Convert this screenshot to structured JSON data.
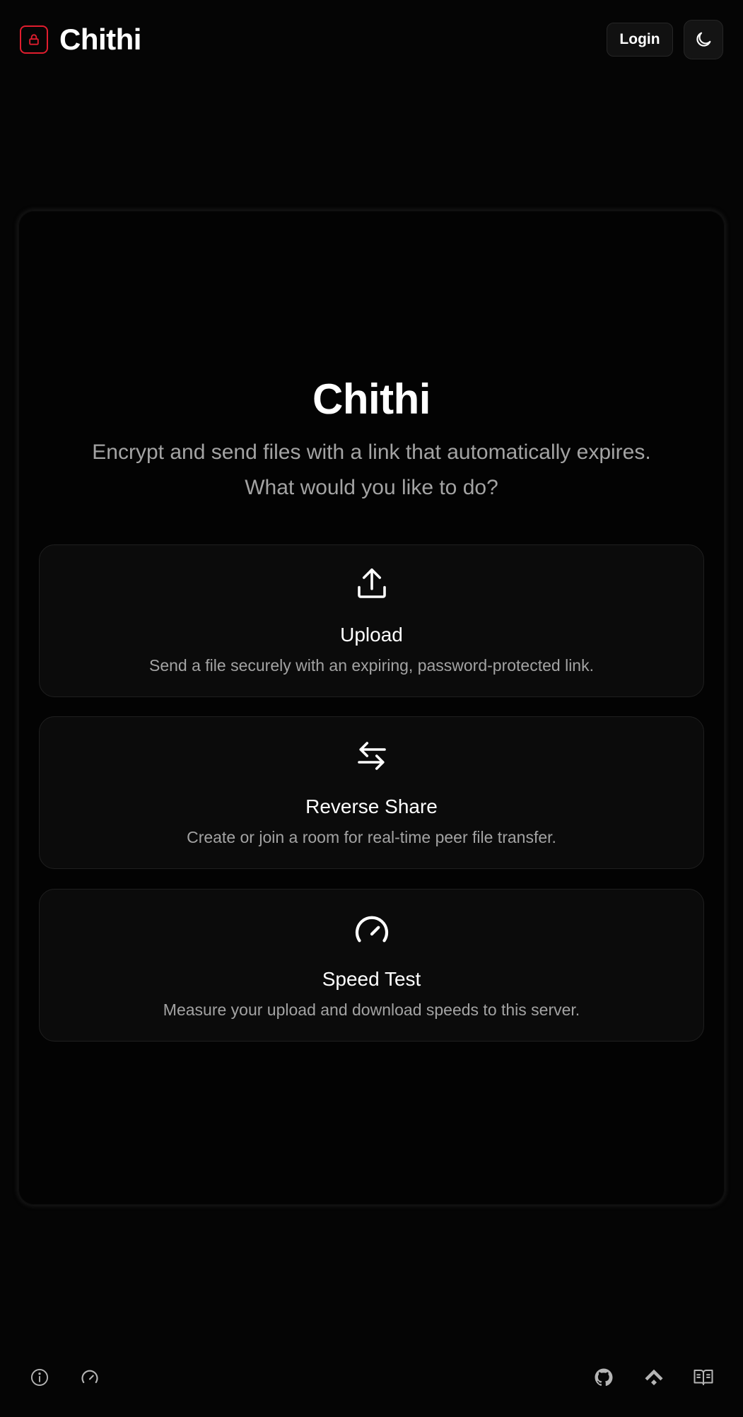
{
  "header": {
    "brand_name": "Chithi",
    "login_label": "Login",
    "icons": {
      "logo": "lock-icon",
      "theme_toggle": "moon-icon"
    }
  },
  "hero": {
    "title": "Chithi",
    "subtitle_line1": "Encrypt and send files with a link that automatically expires.",
    "subtitle_line2": "What would you like to do?"
  },
  "options": [
    {
      "title": "Upload",
      "description": "Send a file securely with an expiring, password-protected link.",
      "icon": "upload-icon"
    },
    {
      "title": "Reverse Share",
      "description": "Create or join a room for real-time peer file transfer.",
      "icon": "arrows-left-right-icon"
    },
    {
      "title": "Speed Test",
      "description": "Measure your upload and download speeds to this server.",
      "icon": "gauge-icon"
    }
  ],
  "footer": {
    "left_icons": [
      "info-icon",
      "gauge-icon"
    ],
    "right_icons": [
      "github-icon",
      "ko-fi-icon",
      "docs-book-icon"
    ]
  },
  "colors": {
    "background": "#050505",
    "accent": "#e11d2e",
    "text_primary": "#ffffff",
    "text_muted": "#a3a3a3",
    "card_bg": "#0b0b0b",
    "card_border": "#1f1f1f"
  }
}
